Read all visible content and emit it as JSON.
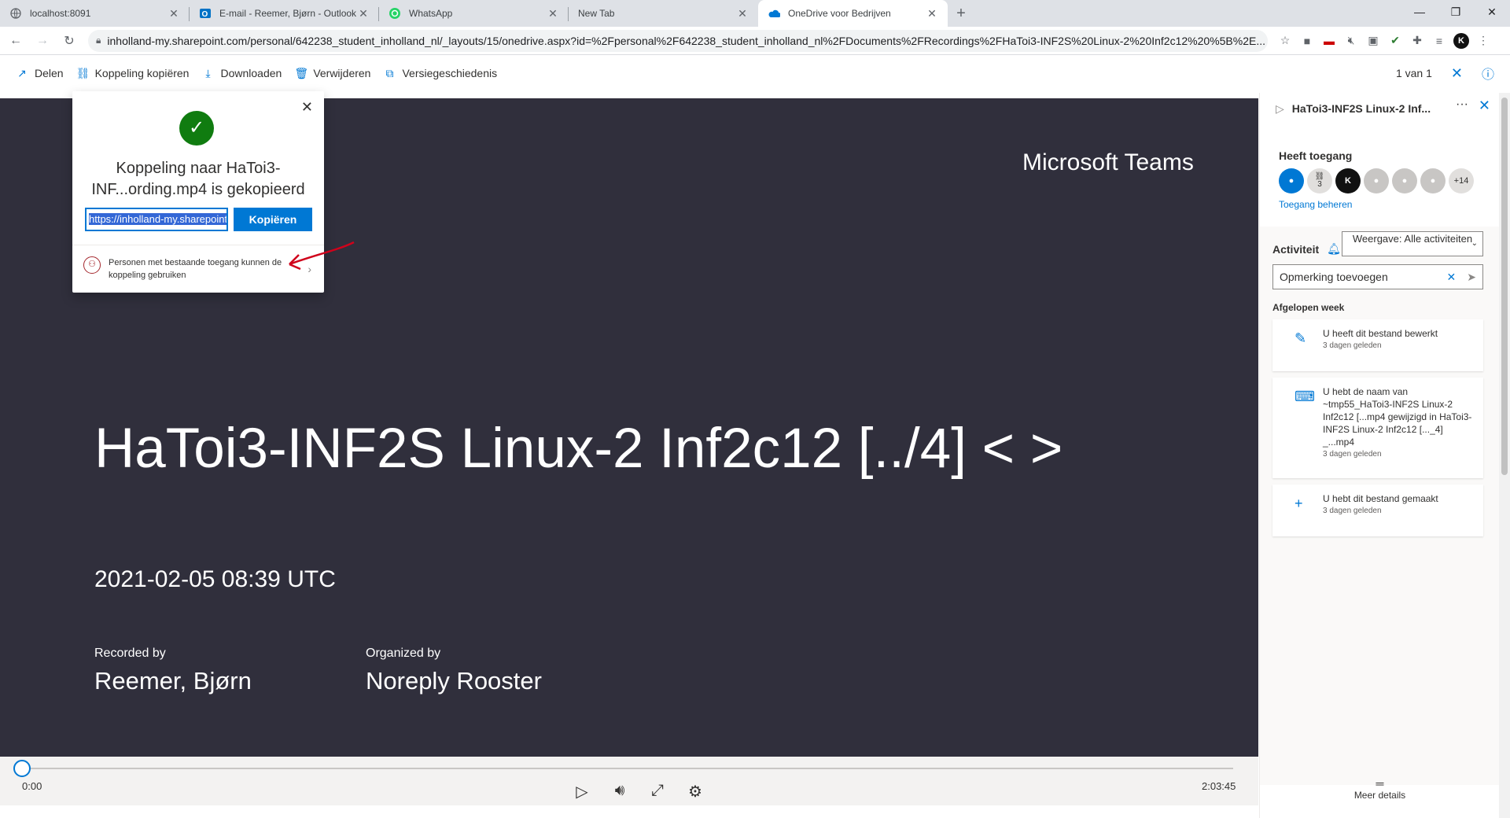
{
  "browser": {
    "tabs": [
      {
        "title": "localhost:8091",
        "icon": "globe-icon"
      },
      {
        "title": "E-mail - Reemer, Bjørn - Outlook",
        "icon": "outlook-icon"
      },
      {
        "title": "WhatsApp",
        "icon": "whatsapp-icon"
      },
      {
        "title": "New Tab",
        "icon": ""
      },
      {
        "title": "OneDrive voor Bedrijven",
        "icon": "onedrive-icon",
        "active": true
      }
    ],
    "url": "inholland-my.sharepoint.com/personal/642238_student_inholland_nl/_layouts/15/onedrive.aspx?id=%2Fpersonal%2F642238_student_inholland_nl%2FDocuments%2FRecordings%2FHaToi3-INF2S%20Linux-2%20Inf2c12%20%5B%2E..."
  },
  "commandbar": {
    "delen": "Delen",
    "koppeling": "Koppeling kopiëren",
    "downloaden": "Downloaden",
    "verwijderen": "Verwijderen",
    "versie": "Versiegeschiedenis",
    "counter": "1 van 1"
  },
  "video": {
    "brand": "Microsoft Teams",
    "title": "HaToi3-INF2S Linux-2 Inf2c12 [../4] < >",
    "date": "2021-02-05 08:39 UTC",
    "recorded_label": "Recorded by",
    "recorded_value": "Reemer, Bjørn",
    "organized_label": "Organized by",
    "organized_value": "Noreply Rooster",
    "time_current": "0:00",
    "time_total": "2:03:45"
  },
  "popup": {
    "title": "Koppeling naar HaToi3-INF...ording.mp4 is gekopieerd",
    "url": "https://inholland-my.sharepoint.com",
    "copy_button": "Kopiëren",
    "footer": "Personen met bestaande toegang kunnen de koppeling gebruiken"
  },
  "panel": {
    "file_title": "HaToi3-INF2S Linux-2 Inf...",
    "access_title": "Heeft toegang",
    "link_count": "3",
    "extra_count": "+14",
    "manage": "Toegang beheren",
    "activity": "Activiteit",
    "view_option": "Weergave: Alle activiteiten",
    "comment_placeholder": "Opmerking toevoegen",
    "last_week": "Afgelopen week",
    "activities": [
      {
        "text": "U heeft dit bestand bewerkt",
        "date": "3 dagen geleden"
      },
      {
        "text": "U hebt de naam van ~tmp55_HaToi3-INF2S Linux-2 Inf2c12 [...mp4 gewijzigd in HaToi3-INF2S Linux-2 Inf2c12 [..._4] _...mp4",
        "date": "3 dagen geleden"
      },
      {
        "text": "U hebt dit bestand gemaakt",
        "date": "3 dagen geleden"
      }
    ],
    "more_details": "Meer details"
  },
  "colors": {
    "accent": "#0078d4",
    "video_bg": "#302f3c",
    "success": "#107c10"
  }
}
